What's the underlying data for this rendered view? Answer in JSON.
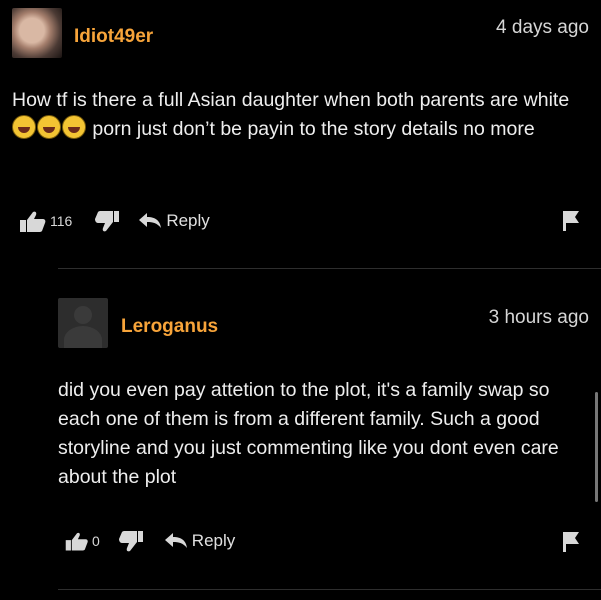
{
  "comments": [
    {
      "username": "Idiot49er",
      "time": "4 days ago",
      "text_before": "How tf is there a full Asian daughter when both parents are white",
      "emojis": [
        "face-with-tears-of-joy-icon",
        "face-with-tears-of-joy-icon",
        "face-with-tears-of-joy-icon"
      ],
      "text_after": "porn just don’t be payin to the story details no more",
      "likes": "116",
      "reply_label": "Reply"
    },
    {
      "username": "Leroganus",
      "time": "3 hours ago",
      "text": "did you even pay attetion to the plot, it's a family swap so each one of them is from a different family. Such a good storyline and you just commenting like you dont even care about the plot",
      "likes": "0",
      "reply_label": "Reply"
    }
  ],
  "colors": {
    "username": "#f7a43a",
    "background": "#000000",
    "text": "#eeeeee"
  }
}
